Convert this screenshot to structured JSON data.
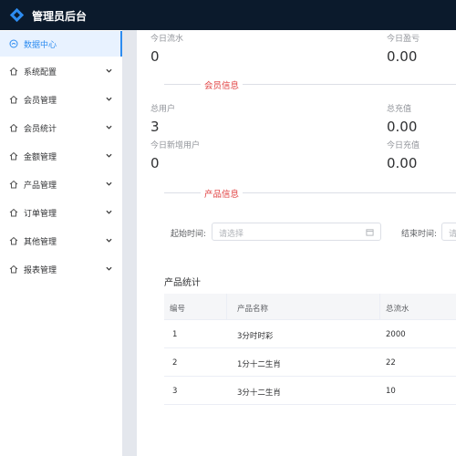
{
  "header": {
    "brand": "管理员后台"
  },
  "sidebar": {
    "items": [
      {
        "label": "数据中心",
        "icon": "gauge-icon",
        "active": true,
        "has_arrow": false
      },
      {
        "label": "系统配置",
        "icon": "home-icon",
        "active": false,
        "has_arrow": true
      },
      {
        "label": "会员管理",
        "icon": "home-icon",
        "active": false,
        "has_arrow": true
      },
      {
        "label": "会员统计",
        "icon": "home-icon",
        "active": false,
        "has_arrow": true
      },
      {
        "label": "金额管理",
        "icon": "home-icon",
        "active": false,
        "has_arrow": true
      },
      {
        "label": "产品管理",
        "icon": "home-icon",
        "active": false,
        "has_arrow": true
      },
      {
        "label": "订单管理",
        "icon": "home-icon",
        "active": false,
        "has_arrow": true
      },
      {
        "label": "其他管理",
        "icon": "home-icon",
        "active": false,
        "has_arrow": true
      },
      {
        "label": "报表管理",
        "icon": "home-icon",
        "active": false,
        "has_arrow": true
      }
    ]
  },
  "finance": {
    "today_flow_label": "今日流水",
    "today_flow_value": "0",
    "today_profit_label": "今日盈亏",
    "today_profit_value": "0.00"
  },
  "member_section": {
    "title": "会员信息",
    "total_users_label": "总用户",
    "total_users_value": "3",
    "total_recharge_label": "总充值",
    "total_recharge_value": "0.00",
    "new_users_today_label": "今日新增用户",
    "new_users_today_value": "0",
    "recharge_today_label": "今日充值",
    "recharge_today_value": "0.00"
  },
  "product_section": {
    "title": "产品信息",
    "start_label": "起始时间:",
    "start_placeholder": "请选择",
    "end_label": "结束时间:",
    "end_placeholder": "请"
  },
  "product_table": {
    "title": "产品统计",
    "columns": [
      "编号",
      "产品名称",
      "总流水"
    ],
    "rows": [
      [
        "1",
        "3分时时彩",
        "2000"
      ],
      [
        "2",
        "1分十二生肖",
        "22"
      ],
      [
        "3",
        "3分十二生肖",
        "10"
      ]
    ]
  },
  "colors": {
    "topbar": "#0b1a2c",
    "accent": "#2d8cf0",
    "section_title": "#e04040"
  }
}
